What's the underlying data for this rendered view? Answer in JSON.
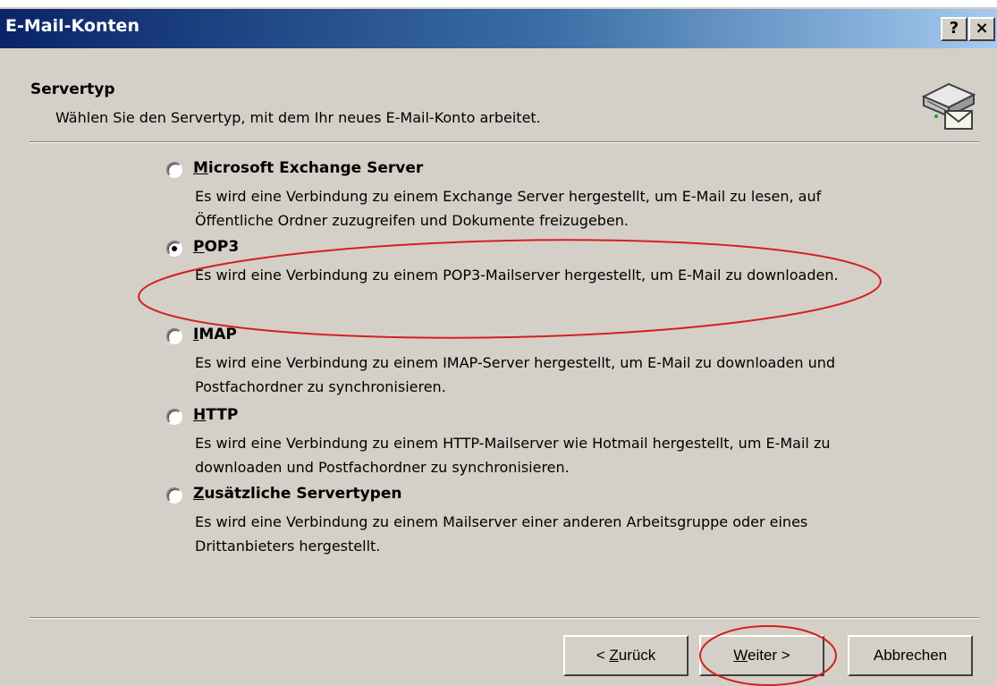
{
  "window": {
    "title": "E-Mail-Konten",
    "help_label": "?",
    "close_label": "×"
  },
  "header": {
    "title": "Servertyp",
    "subtitle": "Wählen Sie den Servertyp, mit dem Ihr neues E-Mail-Konto arbeitet.",
    "icon": "mail-server-icon"
  },
  "options": [
    {
      "accel": "M",
      "rest": "icrosoft Exchange Server",
      "description": "Es wird eine Verbindung zu einem Exchange Server hergestellt, um E-Mail zu lesen, auf Öffentliche Ordner zuzugreifen und Dokumente freizugeben.",
      "checked": false
    },
    {
      "accel": "P",
      "rest": "OP3",
      "description": "Es wird eine Verbindung zu einem POP3-Mailserver hergestellt, um E-Mail zu downloaden.",
      "checked": true
    },
    {
      "accel": "I",
      "rest": "MAP",
      "description": "Es wird eine Verbindung zu einem IMAP-Server hergestellt, um E-Mail zu downloaden und Postfachordner zu synchronisieren.",
      "checked": false
    },
    {
      "accel": "H",
      "rest": "TTP",
      "description": "Es wird eine Verbindung zu einem HTTP-Mailserver wie Hotmail hergestellt, um E-Mail zu downloaden und Postfachordner zu synchronisieren.",
      "checked": false
    },
    {
      "accel": "Z",
      "rest": "usätzliche Servertypen",
      "description": "Es wird eine Verbindung zu einem Mailserver einer anderen Arbeitsgruppe oder eines Drittanbieters hergestellt.",
      "checked": false
    }
  ],
  "buttons": {
    "back": {
      "prefix": "< ",
      "accel": "Z",
      "rest": "urück"
    },
    "next": {
      "accel": "W",
      "rest": "eiter",
      "suffix": " >"
    },
    "cancel": "Abbrechen"
  },
  "colors": {
    "face": "#d4d0c8",
    "title_gradient_start": "#0a246a",
    "annotation": "#d42020"
  }
}
